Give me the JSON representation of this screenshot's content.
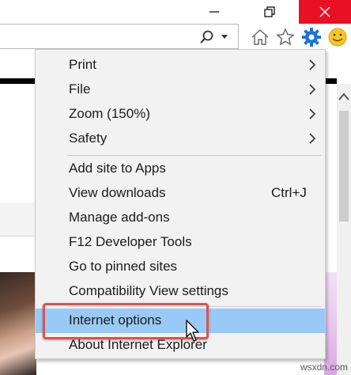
{
  "window_controls": {
    "minimize_icon": "minimize-icon",
    "restore_icon": "restore-icon",
    "close_icon": "close-icon",
    "close_color": "#e81123"
  },
  "toolbar": {
    "search_icon": "search-icon",
    "dropdown_icon": "chevron-down-icon",
    "home_icon": "home-icon",
    "favorites_icon": "star-icon",
    "tools_icon": "gear-icon",
    "feedback_icon": "smiley-icon",
    "tools_color": "#1e73d2",
    "feedback_color": "#f7c623"
  },
  "menu": {
    "items": [
      {
        "label": "Print",
        "has_submenu": true
      },
      {
        "label": "File",
        "has_submenu": true
      },
      {
        "label": "Zoom (150%)",
        "has_submenu": true
      },
      {
        "label": "Safety",
        "has_submenu": true
      },
      {
        "label": "Add site to Apps"
      },
      {
        "label": "View downloads",
        "shortcut": "Ctrl+J"
      },
      {
        "label": "Manage add-ons"
      },
      {
        "label": "F12 Developer Tools"
      },
      {
        "label": "Go to pinned sites"
      },
      {
        "label": "Compatibility View settings"
      },
      {
        "label": "Internet options",
        "highlighted": true
      },
      {
        "label": "About Internet Explorer"
      }
    ],
    "highlight_color": "#99c9f6",
    "callout_color": "#e2504a"
  },
  "watermark": "wsxdn.com"
}
